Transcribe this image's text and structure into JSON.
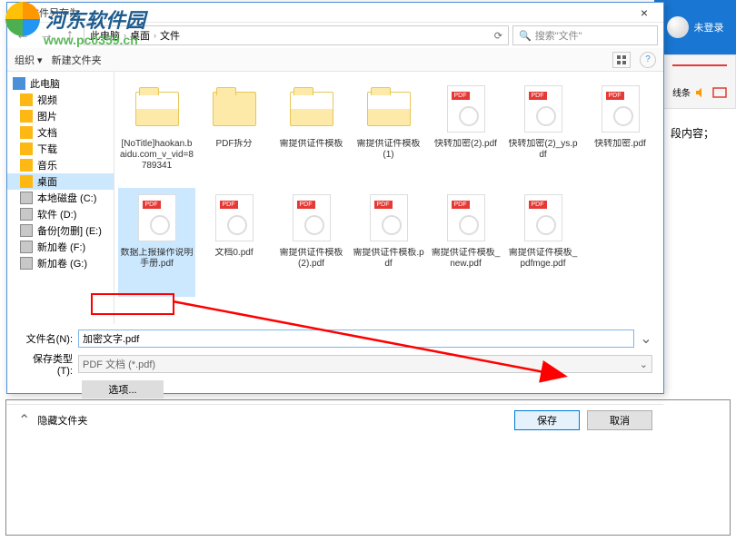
{
  "bg": {
    "login": "未登录",
    "lines_label": "线条",
    "content_snippet": "段内容；"
  },
  "dialog": {
    "title": "文件另存为",
    "close": "×"
  },
  "breadcrumb": {
    "back": "←",
    "fwd": "→",
    "up": "↑",
    "parts": [
      "此电脑",
      "桌面",
      "文件"
    ],
    "sep": "›",
    "refresh": "⟳",
    "search_placeholder": "搜索\"文件\""
  },
  "toolbar": {
    "organize": "组织 ▾",
    "newfolder": "新建文件夹",
    "help": "?"
  },
  "sidebar": {
    "items": [
      {
        "label": "此电脑",
        "icon": "ico-pc",
        "top": true
      },
      {
        "label": "视频",
        "icon": "ico-folder"
      },
      {
        "label": "图片",
        "icon": "ico-folder"
      },
      {
        "label": "文档",
        "icon": "ico-folder"
      },
      {
        "label": "下载",
        "icon": "ico-folder"
      },
      {
        "label": "音乐",
        "icon": "ico-music"
      },
      {
        "label": "桌面",
        "icon": "ico-folder",
        "selected": true
      },
      {
        "label": "本地磁盘 (C:)",
        "icon": "ico-drive"
      },
      {
        "label": "软件 (D:)",
        "icon": "ico-drive"
      },
      {
        "label": "备份[勿删] (E:)",
        "icon": "ico-drive"
      },
      {
        "label": "新加卷 (F:)",
        "icon": "ico-drive"
      },
      {
        "label": "新加卷 (G:)",
        "icon": "ico-drive"
      }
    ]
  },
  "files": {
    "items": [
      {
        "label": "[NoTitle]haokan.baidu.com_v_vid=8789341",
        "type": "folder-preview"
      },
      {
        "label": "PDF拆分",
        "type": "folder"
      },
      {
        "label": "需提供证件模板",
        "type": "folder-preview"
      },
      {
        "label": "需提供证件模板 (1)",
        "type": "folder-preview"
      },
      {
        "label": "快转加密(2).pdf",
        "type": "pdf"
      },
      {
        "label": "快转加密(2)_ys.pdf",
        "type": "pdf"
      },
      {
        "label": "快转加密.pdf",
        "type": "pdf"
      },
      {
        "label": "数据上报操作说明手册.pdf",
        "type": "pdf",
        "selected": true
      },
      {
        "label": "文档0.pdf",
        "type": "pdf"
      },
      {
        "label": "需提供证件模板(2).pdf",
        "type": "pdf"
      },
      {
        "label": "需提供证件模板.pdf",
        "type": "pdf"
      },
      {
        "label": "需提供证件模板_new.pdf",
        "type": "pdf"
      },
      {
        "label": "需提供证件模板_pdfmge.pdf",
        "type": "pdf"
      }
    ]
  },
  "inputs": {
    "filename_label": "文件名(N):",
    "filename_value": "加密文字.pdf",
    "type_label": "保存类型(T):",
    "type_value": "PDF 文档 (*.pdf)",
    "options": "选项..."
  },
  "footer": {
    "hide": "隐藏文件夹",
    "save": "保存",
    "cancel": "取消"
  },
  "watermark": {
    "name": "河东软件园",
    "url": "www.pc0359.cn"
  }
}
